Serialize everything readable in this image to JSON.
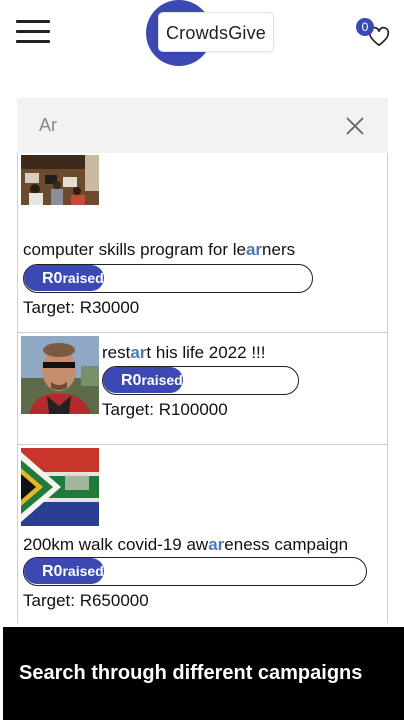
{
  "header": {
    "logo_text": "CrowdsGive",
    "favorites_count": "0",
    "menu_icon": "hamburger-icon",
    "favorites_icon": "heart-icon"
  },
  "search": {
    "value": "Ar",
    "clear_icon": "close-icon"
  },
  "campaigns": [
    {
      "title_parts": [
        "computer skills program for le",
        "ar",
        "ners"
      ],
      "raised_amount": "R0",
      "raised_label": "raised",
      "target": "Target: R30000",
      "image": "classroom-photo"
    },
    {
      "title_parts": [
        "rest",
        "ar",
        "t his life 2022 !!!"
      ],
      "raised_amount": "R0",
      "raised_label": "raised",
      "target": "Target: R100000",
      "image": "man-portrait-photo"
    },
    {
      "title_parts": [
        "200km walk covid-19 aw",
        "ar",
        "eness campaign"
      ],
      "raised_amount": "R0",
      "raised_label": "raised",
      "target": "Target: R650000",
      "image": "south-africa-flag-photo"
    }
  ],
  "caption": "Search through different campaigns",
  "colors": {
    "brand": "#3c49b3",
    "highlight": "#4d7ab3",
    "caption_bg": "#000000"
  }
}
